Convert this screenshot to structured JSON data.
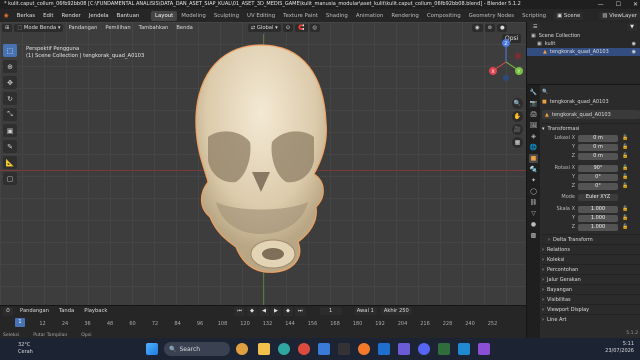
{
  "window": {
    "title": "* kulit.caput_collum_06fb92bb08 [C:\\FUNDAMENTAL ANALISIS\\DATA_DAN_ASET_SIAP_KUAL\\01_ASET_3D_MEDIS_GAME\\kulit_manusia_modular\\aset_kulit\\kulit.caput_collum_06fb92bb08.blend] - Blender 5.1.2",
    "min": "—",
    "max": "☐",
    "close": "✕"
  },
  "menubar": {
    "items": [
      "Berkas",
      "Edit",
      "Render",
      "Jendela",
      "Bantuan"
    ],
    "workspaces": [
      "Layout",
      "Modeling",
      "Sculpting",
      "UV Editing",
      "Texture Paint",
      "Shading",
      "Animation",
      "Rendering",
      "Compositing",
      "Geometry Nodes",
      "Scripting"
    ],
    "active_workspace": "Layout",
    "scene": "Scene",
    "view_layer": "ViewLayer"
  },
  "viewport": {
    "mode": "Mode Benda",
    "menus": [
      "Pandangan",
      "Pemilihan",
      "Tambahkan",
      "Benda"
    ],
    "transform_orientation": "Global",
    "options": "Opsi",
    "overlay_line1": "Perspektif Pengguna",
    "overlay_line2": "(1) Scene Collection | tengkorak_quad_A0103",
    "gizmo": {
      "x": "X",
      "y": "Y",
      "z": "Z"
    }
  },
  "timeline": {
    "menus": [
      "Pandangan",
      "Tanda",
      "Playback"
    ],
    "current_frame": "1",
    "start_label": "Awal",
    "start": "1",
    "end_label": "Akhir",
    "end": "250",
    "ticks": [
      "1",
      "12",
      "24",
      "36",
      "48",
      "60",
      "72",
      "84",
      "96",
      "108",
      "120",
      "132",
      "144",
      "156",
      "168",
      "180",
      "192",
      "204",
      "216",
      "228",
      "240",
      "252"
    ],
    "footer": [
      "Seleksi",
      "Putar Tampilan",
      "Opsi"
    ]
  },
  "outliner": {
    "rows": [
      "Scene Collection",
      "kulit",
      "tengkorak_quad_A0103"
    ]
  },
  "properties": {
    "search_placeholder": "",
    "object_name": "tengkorak_quad_A0103",
    "object_name2": "tengkorak_quad_A0103",
    "transform_header": "Transformasi",
    "location_label": "Lokasi X",
    "location": [
      "0 m",
      "0 m",
      "0 m"
    ],
    "rotation_label": "Rotasi X",
    "rotation": [
      "90°",
      "0°",
      "0°"
    ],
    "mode_label": "Mode",
    "mode_value": "Euler XYZ",
    "scale_label": "Skala X",
    "scale": [
      "1.000",
      "1.000",
      "1.000"
    ],
    "y_label": "Y",
    "z_label": "Z",
    "sections": [
      "Delta Transform",
      "Relations",
      "Koleksi",
      "Percontohan",
      "Jalur Gerakan",
      "Bayangan",
      "Visibilitas",
      "Viewport Display",
      "Line Art"
    ],
    "version": "5.1.2"
  },
  "taskbar": {
    "temp": "32°C",
    "weather": "Cerah",
    "search": "Search",
    "time": "5:11",
    "date": "23/07/2026"
  },
  "colors": {
    "accent": "#4772b3",
    "selection": "#334d80",
    "skull": "#e9dcc4"
  }
}
